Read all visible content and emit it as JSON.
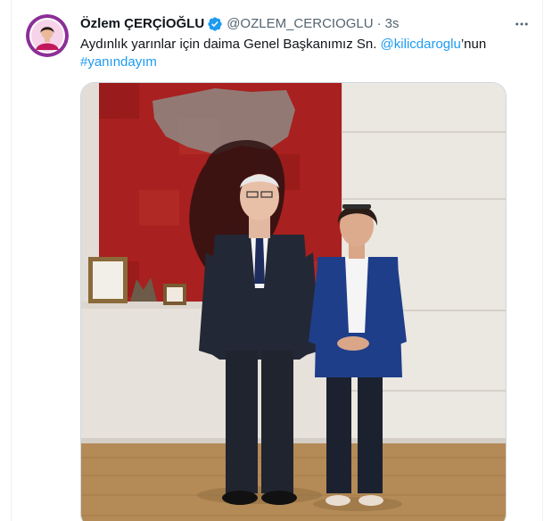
{
  "tweet": {
    "author": {
      "display_name": "Özlem ÇERÇİOĞLU",
      "handle": "@OZLEM_CERCIOGLU",
      "verified": true
    },
    "separator": "·",
    "time": "3s",
    "text": {
      "part1": "Aydınlık yarınlar için daima Genel Başkanımız Sn. ",
      "mention": "@kilicdaroglu",
      "part2": "’nun",
      "hashtag": "#yanındayım"
    },
    "media": {
      "type": "photo"
    }
  },
  "colors": {
    "text_primary": "#0f1419",
    "text_secondary": "#536471",
    "link": "#1d9bf0",
    "verified_badge": "#1d9bf0",
    "avatar_ring": "#7b2c8a"
  },
  "icons": {
    "verified": "verified-badge-icon",
    "more": "more-horizontal-icon"
  }
}
